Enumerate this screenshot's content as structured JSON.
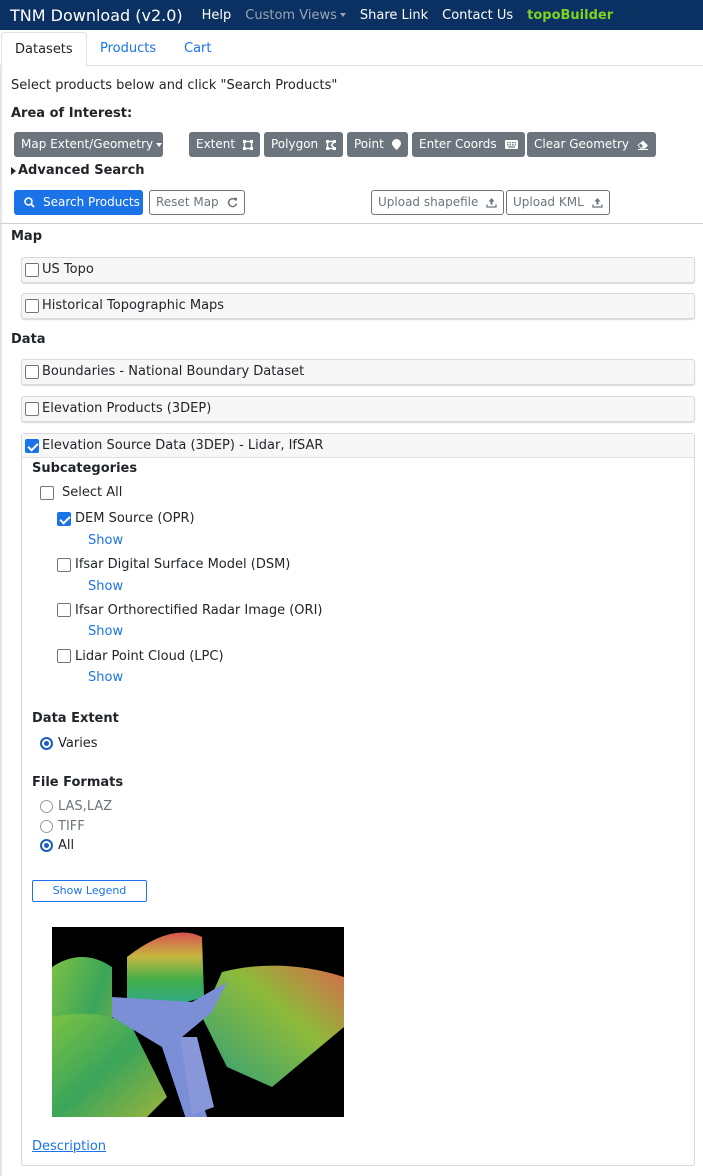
{
  "navbar": {
    "brand": "TNM Download (v2.0)",
    "links": [
      {
        "label": "Help"
      },
      {
        "label": "Custom Views"
      },
      {
        "label": "Share Link"
      },
      {
        "label": "Contact Us"
      },
      {
        "label": "topoBuilder"
      }
    ]
  },
  "tabs": [
    {
      "label": "Datasets",
      "active": true
    },
    {
      "label": "Products",
      "active": false
    },
    {
      "label": "Cart",
      "active": false
    }
  ],
  "intro": "Select products below and click \"Search Products\"",
  "area_of_interest": {
    "label": "Area of Interest:",
    "dropdown_label": "Map Extent/Geometry",
    "geometry_buttons": [
      {
        "label": "Extent",
        "icon": "extent-icon"
      },
      {
        "label": "Polygon",
        "icon": "polygon-icon"
      },
      {
        "label": "Point",
        "icon": "map-pin-icon"
      },
      {
        "label": "Enter Coords",
        "icon": "keyboard-icon"
      },
      {
        "label": "Clear Geometry",
        "icon": "eraser-icon"
      }
    ]
  },
  "advanced_search": "Advanced Search",
  "actions": {
    "search": "Search Products",
    "reset": "Reset Map",
    "upload_shapefile": "Upload shapefile",
    "upload_kml": "Upload KML"
  },
  "sections": {
    "map": {
      "title": "Map",
      "items": [
        {
          "label": "US Topo",
          "checked": false
        },
        {
          "label": "Historical Topographic Maps",
          "checked": false
        }
      ]
    },
    "data": {
      "title": "Data",
      "items": [
        {
          "label": "Boundaries - National Boundary Dataset",
          "checked": false
        },
        {
          "label": "Elevation Products (3DEP)",
          "checked": false
        },
        {
          "label": "Elevation Source Data (3DEP) - Lidar, IfSAR",
          "checked": true
        }
      ]
    }
  },
  "expanded": {
    "subcategories_title": "Subcategories",
    "select_all": "Select All",
    "subcategories": [
      {
        "label": "DEM Source (OPR)",
        "checked": true,
        "link": "Show"
      },
      {
        "label": "Ifsar Digital Surface Model (DSM)",
        "checked": false,
        "link": "Show"
      },
      {
        "label": "Ifsar Orthorectified Radar Image (ORI)",
        "checked": false,
        "link": "Show"
      },
      {
        "label": "Lidar Point Cloud (LPC)",
        "checked": false,
        "link": "Show"
      }
    ],
    "data_extent": {
      "title": "Data Extent",
      "options": [
        {
          "label": "Varies",
          "selected": true
        }
      ]
    },
    "file_formats": {
      "title": "File Formats",
      "options": [
        {
          "label": "LAS,LAZ",
          "selected": false
        },
        {
          "label": "TIFF",
          "selected": false
        },
        {
          "label": "All",
          "selected": true
        }
      ]
    },
    "legend_button": "Show Legend",
    "preview_image": "lidar-elevation-3d-preview",
    "description_link": "Description"
  },
  "colors": {
    "navbar": "#0a3161",
    "primary": "#1a73e8",
    "secondary": "#6c757d",
    "topobuilder": "#7ed321"
  }
}
